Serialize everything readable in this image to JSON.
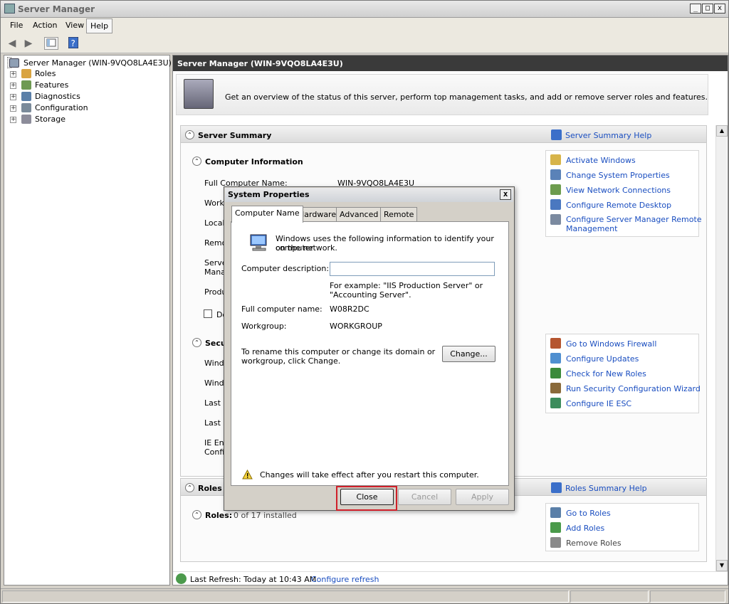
{
  "window": {
    "title": "Server Manager",
    "minimize": "_",
    "maximize": "□",
    "close": "x"
  },
  "menubar": [
    "File",
    "Action",
    "View",
    "Help"
  ],
  "tree": {
    "root": "Server Manager (WIN-9VQO8LA4E3U)",
    "items": [
      "Roles",
      "Features",
      "Diagnostics",
      "Configuration",
      "Storage"
    ]
  },
  "main": {
    "header": "Server Manager (WIN-9VQO8LA4E3U)",
    "overview": "Get an overview of the status of this server, perform top management tasks, and add or remove server roles and features.",
    "server_summary": {
      "title": "Server Summary",
      "help": "Server Summary Help",
      "computer_info": {
        "title": "Computer Information",
        "rows": [
          {
            "label": "Full Computer Name:",
            "value": "WIN-9VQO8LA4E3U"
          },
          {
            "label": "Workg"
          },
          {
            "label": "Local"
          },
          {
            "label": "Remo"
          },
          {
            "label": "Serve"
          },
          {
            "label": "Mana"
          },
          {
            "label": "Produ"
          }
        ],
        "checkbox_label": "Do",
        "links": [
          "Activate Windows",
          "Change System Properties",
          "View Network Connections",
          "Configure Remote Desktop",
          "Configure Server Manager Remote",
          "Management"
        ]
      },
      "security": {
        "title": "Secu",
        "rows": [
          "Windo",
          "Windo",
          "Last c",
          "Last i",
          "IE Enh",
          "Confi"
        ],
        "links": [
          "Go to Windows Firewall",
          "Configure Updates",
          "Check for New Roles",
          "Run Security Configuration Wizard",
          "Configure IE ESC"
        ]
      }
    },
    "roles_summary": {
      "title": "Roles S",
      "help": "Roles Summary Help",
      "roles_label": "Roles:",
      "roles_count": "0 of 17 installed",
      "links": [
        "Go to Roles",
        "Add Roles",
        "Remove Roles"
      ]
    },
    "footer": {
      "refresh": "Last Refresh: Today at 10:43 AM",
      "configure": "Configure refresh"
    }
  },
  "dialog": {
    "title": "System Properties",
    "close": "x",
    "tabs": [
      "Computer Name",
      "Hardware",
      "Advanced",
      "Remote"
    ],
    "intro_line1": "Windows uses the following information to identify your computer",
    "intro_line2": "on the network.",
    "description_label": "Computer description:",
    "description_value": "",
    "example_line1": "For example: \"IIS Production Server\" or",
    "example_line2": "\"Accounting Server\".",
    "full_name_label": "Full computer name:",
    "full_name_value": "W08R2DC",
    "workgroup_label": "Workgroup:",
    "workgroup_value": "WORKGROUP",
    "rename_line1": "To rename this computer or change its domain or",
    "rename_line2": "workgroup, click Change.",
    "change_button": "Change...",
    "warning": "Changes will take effect after you restart this computer.",
    "buttons": {
      "close": "Close",
      "cancel": "Cancel",
      "apply": "Apply"
    }
  },
  "colors": {
    "link": "#1a4ec0",
    "highlight": "#d0202a",
    "header_bg": "#3a3a3a"
  }
}
